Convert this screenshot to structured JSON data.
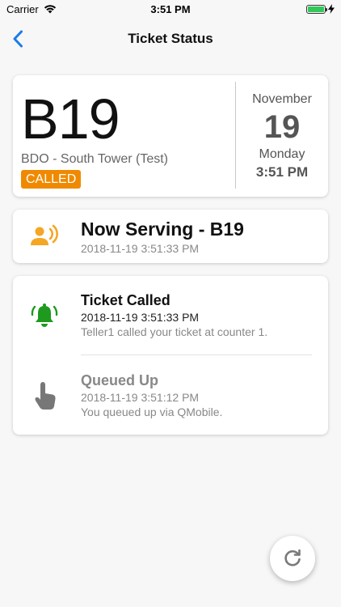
{
  "status_bar": {
    "carrier": "Carrier",
    "time": "3:51 PM",
    "battery_level": 1.0
  },
  "nav": {
    "title": "Ticket Status",
    "back_icon": "chevron-left-icon"
  },
  "ticket": {
    "number": "B19",
    "branch": "BDO - South Tower (Test)",
    "status": "CALLED",
    "date": {
      "month": "November",
      "day": "19",
      "weekday": "Monday",
      "time": "3:51 PM"
    }
  },
  "now_serving": {
    "title": "Now Serving - B19",
    "timestamp": "2018-11-19 3:51:33 PM",
    "icon": "person-speaking-icon"
  },
  "history": [
    {
      "title": "Ticket Called",
      "timestamp": "2018-11-19 3:51:33 PM",
      "description": "Teller1 called your ticket at counter 1.",
      "icon": "bell-ringing-icon"
    },
    {
      "title": "Queued Up",
      "timestamp": "2018-11-19 3:51:12 PM",
      "description": "You queued up via QMobile.",
      "icon": "finger-tap-icon"
    }
  ],
  "refresh_icon": "refresh-icon",
  "colors": {
    "accent_blue": "#1a7ce8",
    "called_orange": "#ef8a00",
    "serving_orange": "#f5a623",
    "called_green": "#1e9a1e",
    "queued_gray": "#777777",
    "battery_green": "#34c759"
  }
}
